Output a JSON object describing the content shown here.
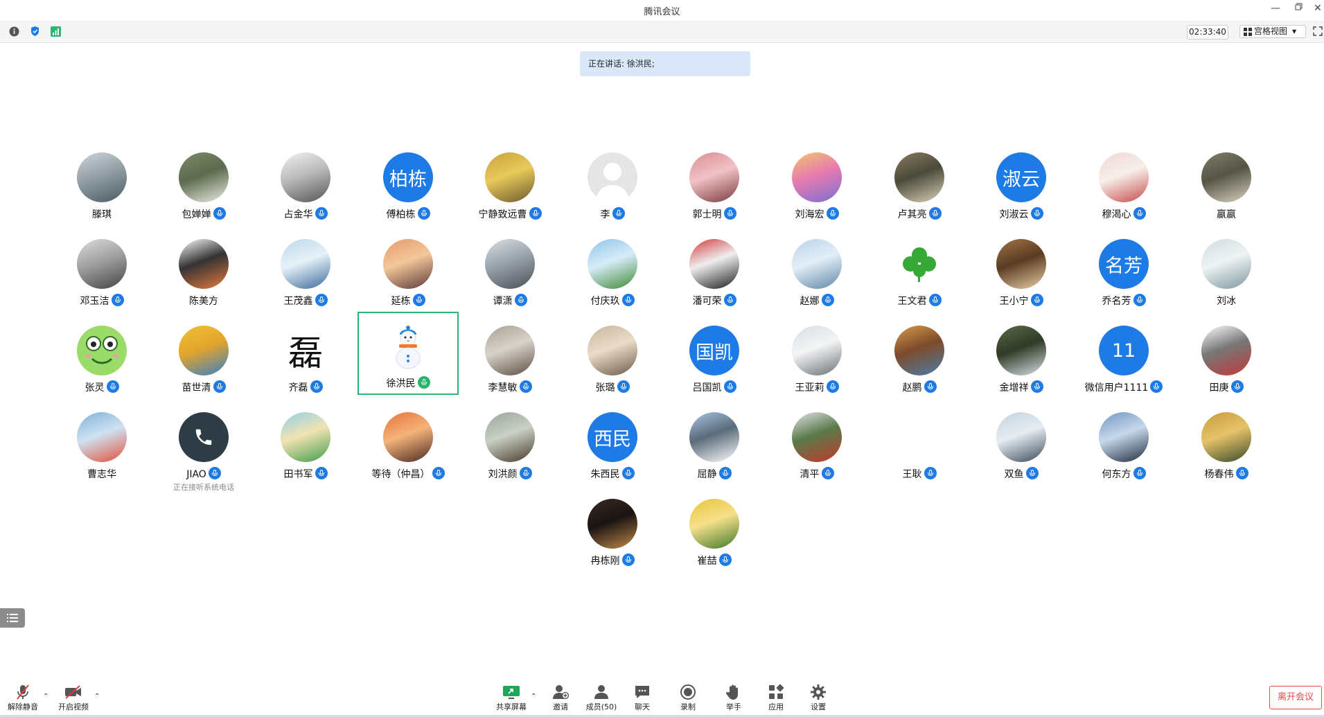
{
  "window": {
    "title": "腾讯会议"
  },
  "toolbar": {
    "timer": "02:33:40",
    "view_label": "宫格视图"
  },
  "speaking_banner": "正在讲话: 徐洪民;",
  "participants": [
    {
      "name": "滕琪",
      "mic": false,
      "avatar": {
        "type": "photo",
        "colors": [
          "#cfd6dc",
          "#4c5a62",
          "#93a0a6"
        ]
      }
    },
    {
      "name": "包婵婵",
      "mic": true,
      "avatar": {
        "type": "photo",
        "colors": [
          "#7c8a6a",
          "#e9ede2",
          "#5d6a4d"
        ]
      }
    },
    {
      "name": "占金华",
      "mic": true,
      "avatar": {
        "type": "photo",
        "colors": [
          "#f1f1f1",
          "#555555",
          "#bbbbbb"
        ]
      }
    },
    {
      "name": "傅柏栋",
      "mic": true,
      "avatar": {
        "type": "text",
        "text": "柏栋",
        "bg": "#1e7be6"
      }
    },
    {
      "name": "宁静致远曹",
      "mic": true,
      "avatar": {
        "type": "photo",
        "colors": [
          "#c9a23c",
          "#6b5a2e",
          "#e8c95a"
        ]
      }
    },
    {
      "name": "李",
      "mic": true,
      "avatar": {
        "type": "default",
        "colors": [
          "#e5e5e5",
          "#c8c8c8",
          "#d5d5d5"
        ]
      }
    },
    {
      "name": "郭士明",
      "mic": true,
      "avatar": {
        "type": "photo",
        "colors": [
          "#d98d92",
          "#7a3b3e",
          "#f1c2c5"
        ]
      }
    },
    {
      "name": "刘海宏",
      "mic": true,
      "avatar": {
        "type": "photo",
        "colors": [
          "#f0c66a",
          "#7b6fd1",
          "#e87bb0"
        ]
      }
    },
    {
      "name": "卢其亮",
      "mic": true,
      "avatar": {
        "type": "photo",
        "colors": [
          "#8a7a5e",
          "#d9cfb8",
          "#4b4a3a"
        ]
      }
    },
    {
      "name": "刘淑云",
      "mic": true,
      "avatar": {
        "type": "text",
        "text": "淑云",
        "bg": "#1e7be6"
      }
    },
    {
      "name": "穆渴心",
      "mic": true,
      "avatar": {
        "type": "photo",
        "colors": [
          "#f2d7d7",
          "#c74a4a",
          "#f6efe9"
        ]
      }
    },
    {
      "name": "嬴嬴",
      "mic": false,
      "avatar": {
        "type": "photo",
        "colors": [
          "#7f7f6a",
          "#d8d2c0",
          "#565446"
        ]
      }
    },
    {
      "name": "邓玉洁",
      "mic": true,
      "avatar": {
        "type": "photo",
        "colors": [
          "#dcdcdc",
          "#444444",
          "#a0a0a0"
        ]
      }
    },
    {
      "name": "陈美方",
      "mic": false,
      "avatar": {
        "type": "photo",
        "colors": [
          "#ffffff",
          "#e67a3c",
          "#333333"
        ]
      }
    },
    {
      "name": "王茂鑫",
      "mic": true,
      "avatar": {
        "type": "photo",
        "colors": [
          "#bcd8ec",
          "#3b6a9a",
          "#e6f1f8"
        ]
      }
    },
    {
      "name": "延栋",
      "mic": true,
      "avatar": {
        "type": "photo",
        "colors": [
          "#e59a6a",
          "#5d3a3a",
          "#f3c79a"
        ]
      }
    },
    {
      "name": "谭潇",
      "mic": true,
      "avatar": {
        "type": "photo",
        "colors": [
          "#d8e0e6",
          "#4a5058",
          "#9aa3aa"
        ]
      }
    },
    {
      "name": "付庆玖",
      "mic": true,
      "avatar": {
        "type": "photo",
        "colors": [
          "#8ec4e8",
          "#3f8a34",
          "#d7ecf8"
        ]
      }
    },
    {
      "name": "潘可荣",
      "mic": true,
      "avatar": {
        "type": "photo",
        "colors": [
          "#d33c3c",
          "#1b1b1b",
          "#eeeeee"
        ]
      }
    },
    {
      "name": "赵娜",
      "mic": true,
      "avatar": {
        "type": "photo",
        "colors": [
          "#b9d3ea",
          "#5f86a8",
          "#e3eef7"
        ]
      }
    },
    {
      "name": "王文君",
      "mic": true,
      "avatar": {
        "type": "clover",
        "colors": [
          "#ffffff",
          "#35a836",
          "#7fd36b"
        ]
      }
    },
    {
      "name": "王小宁",
      "mic": true,
      "avatar": {
        "type": "photo",
        "colors": [
          "#a37447",
          "#e8cfa6",
          "#5a3b22"
        ]
      }
    },
    {
      "name": "乔名芳",
      "mic": true,
      "avatar": {
        "type": "text",
        "text": "名芳",
        "bg": "#1e7be6"
      }
    },
    {
      "name": "刘冰",
      "mic": false,
      "avatar": {
        "type": "photo",
        "colors": [
          "#cfdde2",
          "#7b969c",
          "#eef3f4"
        ]
      }
    },
    {
      "name": "张灵",
      "mic": true,
      "avatar": {
        "type": "frog",
        "colors": [
          "#9adb6a",
          "#2c6b22",
          "#ffffff"
        ]
      }
    },
    {
      "name": "苗世清",
      "mic": true,
      "avatar": {
        "type": "photo",
        "colors": [
          "#f0c13a",
          "#3a7fc6",
          "#e4a52a"
        ]
      }
    },
    {
      "name": "齐磊",
      "mic": true,
      "avatar": {
        "type": "calligraphy",
        "text": "磊",
        "colors": [
          "#ffffff",
          "#111111",
          "#ffffff"
        ]
      }
    },
    {
      "name": "徐洪民",
      "mic": true,
      "active": true,
      "mic_color": "green",
      "avatar": {
        "type": "snowman",
        "colors": [
          "#ffffff",
          "#2b86d6",
          "#f07a2a"
        ]
      }
    },
    {
      "name": "李慧敏",
      "mic": true,
      "avatar": {
        "type": "photo",
        "colors": [
          "#a9a196",
          "#5a4f45",
          "#d9d2c7"
        ]
      }
    },
    {
      "name": "张璐",
      "mic": true,
      "avatar": {
        "type": "photo",
        "colors": [
          "#c7b6a0",
          "#6b5a4a",
          "#eadcc8"
        ]
      }
    },
    {
      "name": "吕国凯",
      "mic": true,
      "avatar": {
        "type": "text",
        "text": "国凯",
        "bg": "#1e7be6"
      }
    },
    {
      "name": "王亚莉",
      "mic": true,
      "avatar": {
        "type": "photo",
        "colors": [
          "#d9dee4",
          "#6a6f74",
          "#f3f4f5"
        ]
      }
    },
    {
      "name": "赵鹏",
      "mic": true,
      "avatar": {
        "type": "photo",
        "colors": [
          "#d79a4f",
          "#4c7ba8",
          "#7e4b2a"
        ]
      }
    },
    {
      "name": "金增祥",
      "mic": true,
      "avatar": {
        "type": "photo",
        "colors": [
          "#5b6b4a",
          "#d7e0e6",
          "#2f3b26"
        ]
      }
    },
    {
      "name": "微信用户1111",
      "mic": true,
      "avatar": {
        "type": "text",
        "text": "11",
        "bg": "#1e7be6"
      }
    },
    {
      "name": "田庚",
      "mic": true,
      "avatar": {
        "type": "photo",
        "colors": [
          "#ffffff",
          "#c23a3a",
          "#777777"
        ]
      }
    },
    {
      "name": "曹志华",
      "mic": false,
      "avatar": {
        "type": "photo",
        "colors": [
          "#7fb0d8",
          "#e0503a",
          "#cfe2f1"
        ]
      }
    },
    {
      "name": "JIAO",
      "mic": true,
      "status": "正在接听系统电话",
      "avatar": {
        "type": "phone",
        "colors": [
          "#2e3d45",
          "#ffffff",
          "#2e3d45"
        ]
      }
    },
    {
      "name": "田书军",
      "mic": true,
      "avatar": {
        "type": "photo",
        "colors": [
          "#8fd0e6",
          "#3f9d4a",
          "#f2e3b2"
        ]
      }
    },
    {
      "name": "等待（仲昌）",
      "mic": true,
      "avatar": {
        "type": "photo",
        "colors": [
          "#e8733a",
          "#4a2a22",
          "#f4b37a"
        ]
      }
    },
    {
      "name": "刘洪颜",
      "mic": true,
      "avatar": {
        "type": "photo",
        "colors": [
          "#9aa59a",
          "#4a3a2a",
          "#c9d0c6"
        ]
      }
    },
    {
      "name": "朱西民",
      "mic": true,
      "avatar": {
        "type": "text",
        "text": "西民",
        "bg": "#1e7be6"
      }
    },
    {
      "name": "屈静",
      "mic": true,
      "avatar": {
        "type": "photo",
        "colors": [
          "#a9c6e6",
          "#ffffff",
          "#5a6b7a"
        ]
      }
    },
    {
      "name": "清平",
      "mic": true,
      "avatar": {
        "type": "photo",
        "colors": [
          "#e2e6e8",
          "#c23a2a",
          "#5a7a4a"
        ]
      }
    },
    {
      "name": "王耿",
      "mic": true,
      "avatar": {
        "type": "blank",
        "colors": [
          "#ffffff",
          "#ffffff",
          "#ffffff"
        ]
      }
    },
    {
      "name": "双鱼",
      "mic": true,
      "avatar": {
        "type": "photo",
        "colors": [
          "#c2d2de",
          "#3a4a5a",
          "#e6edf2"
        ]
      }
    },
    {
      "name": "何东方",
      "mic": true,
      "avatar": {
        "type": "photo",
        "colors": [
          "#6f95c2",
          "#1f2d3d",
          "#c8d8ea"
        ]
      }
    },
    {
      "name": "杨春伟",
      "mic": true,
      "avatar": {
        "type": "photo",
        "colors": [
          "#c79a3a",
          "#3a4a2a",
          "#e6c36a"
        ]
      }
    },
    {
      "name": "冉栋刚",
      "mic": true,
      "avatar": {
        "type": "photo",
        "colors": [
          "#3a2a22",
          "#c28a4a",
          "#1a1412"
        ]
      }
    },
    {
      "name": "崔喆",
      "mic": true,
      "avatar": {
        "type": "photo",
        "colors": [
          "#e8c53a",
          "#3f7a2a",
          "#f6e08a"
        ]
      }
    }
  ],
  "bottom_bar": {
    "unmute": "解除静音",
    "start_video": "开启视频",
    "share_screen": "共享屏幕",
    "invite": "邀请",
    "members": "成员(50)",
    "chat": "聊天",
    "record": "录制",
    "raise_hand": "举手",
    "apps": "应用",
    "settings": "设置",
    "leave": "离开会议"
  }
}
